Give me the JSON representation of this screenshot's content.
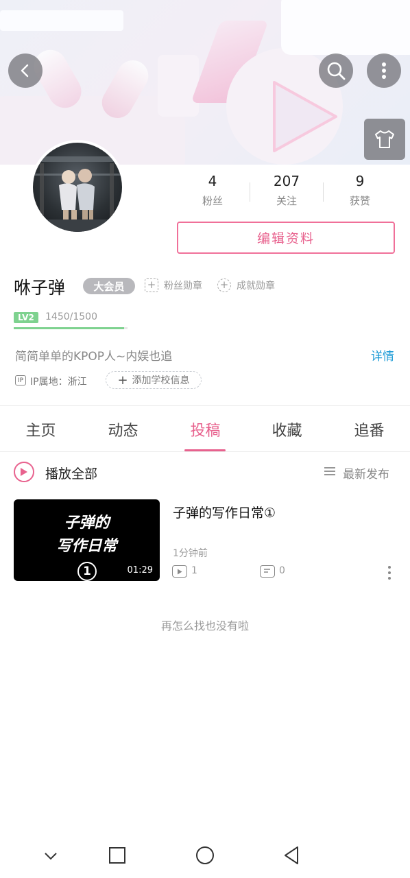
{
  "profile": {
    "username": "咻子弹",
    "vip_badge": "大会员",
    "medal_fans": "粉丝勋章",
    "medal_achievement": "成就勋章",
    "level": "LV2",
    "level_progress_text": "1450/1500",
    "level_progress_fraction": 0.967,
    "bio": "简简单单的KPOP人~内娱也追",
    "details_link": "详情",
    "ip_label": "IP属地：浙江",
    "add_school": "添加学校信息",
    "edit_button": "编辑资料"
  },
  "stats": [
    {
      "value": "4",
      "label": "粉丝"
    },
    {
      "value": "207",
      "label": "关注"
    },
    {
      "value": "9",
      "label": "获赞"
    }
  ],
  "tabs": [
    {
      "label": "主页",
      "active": false
    },
    {
      "label": "动态",
      "active": false
    },
    {
      "label": "投稿",
      "active": true
    },
    {
      "label": "收藏",
      "active": false
    },
    {
      "label": "追番",
      "active": false
    }
  ],
  "list_header": {
    "play_all": "播放全部",
    "sort_label": "最新发布"
  },
  "videos": [
    {
      "thumb_line1": "子弹的",
      "thumb_line2": "写作日常",
      "thumb_number": "1",
      "duration": "01:29",
      "title": "子弹的写作日常①",
      "time": "1分钟前",
      "plays": "1",
      "comments": "0"
    }
  ],
  "end_text": "再怎么找也没有啦",
  "colors": {
    "accent": "#e8628e",
    "link": "#1a9ad6",
    "level": "#7ed28f"
  },
  "icons": [
    "back-icon",
    "search-icon",
    "more-vertical-icon",
    "shirt-icon",
    "plus-icon",
    "play-circle-icon",
    "sort-icon",
    "play-count-icon",
    "comment-icon",
    "nav-back-chevron-icon",
    "nav-recent-icon",
    "nav-home-icon",
    "nav-back-icon"
  ]
}
